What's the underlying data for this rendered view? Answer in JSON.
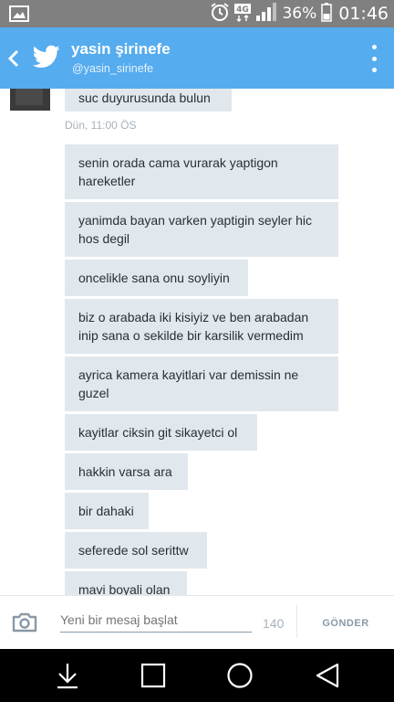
{
  "status_bar": {
    "network_badge": "4G",
    "battery_percent": "36%",
    "time": "01:46",
    "icons": [
      "gallery-icon",
      "alarm-icon",
      "signal-icon",
      "battery-icon"
    ]
  },
  "header": {
    "name": "yasin şirinefe",
    "handle": "@yasin_sirinefe",
    "color": "#55acee"
  },
  "thread": {
    "partial_top_message": "suc duyurusunda bulun",
    "timestamp": "Dün, 11:00 ÖS",
    "messages": [
      "senin orada cama vurarak yaptigon\nhareketler",
      "yanimda bayan varken yaptigin seyler hic\nhos degil",
      "oncelikle sana onu soyliyin",
      "biz o arabada iki kisiyiz ve ben arabadan\ninip sana o sekilde bir karsilik vermedim",
      "ayrica kamera kayitlari var demissin ne\nguzel",
      "kayitlar ciksin git sikayetci ol",
      "hakkin varsa ara",
      "bir dahaki",
      "seferede sol serittw",
      "mavi boyali olan"
    ]
  },
  "composer": {
    "placeholder": "Yeni bir mesaj başlat",
    "char_count": "140",
    "send_label": "GÖNDER"
  },
  "nav_bar": {
    "icons": [
      "download-icon",
      "recents-icon",
      "home-icon",
      "back-icon"
    ]
  }
}
